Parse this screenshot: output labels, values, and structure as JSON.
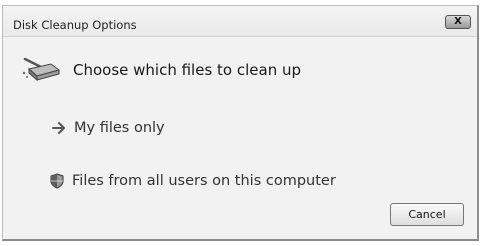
{
  "window": {
    "title": "Disk Cleanup Options",
    "close_label": "X"
  },
  "main": {
    "heading": "Choose which files to clean up",
    "heading_icon": "disk-cleanup-icon",
    "options": [
      {
        "label": "My files only",
        "icon": "arrow-right-icon"
      },
      {
        "label": "Files from all users on this computer",
        "icon": "shield-icon"
      }
    ],
    "cancel_label": "Cancel"
  }
}
